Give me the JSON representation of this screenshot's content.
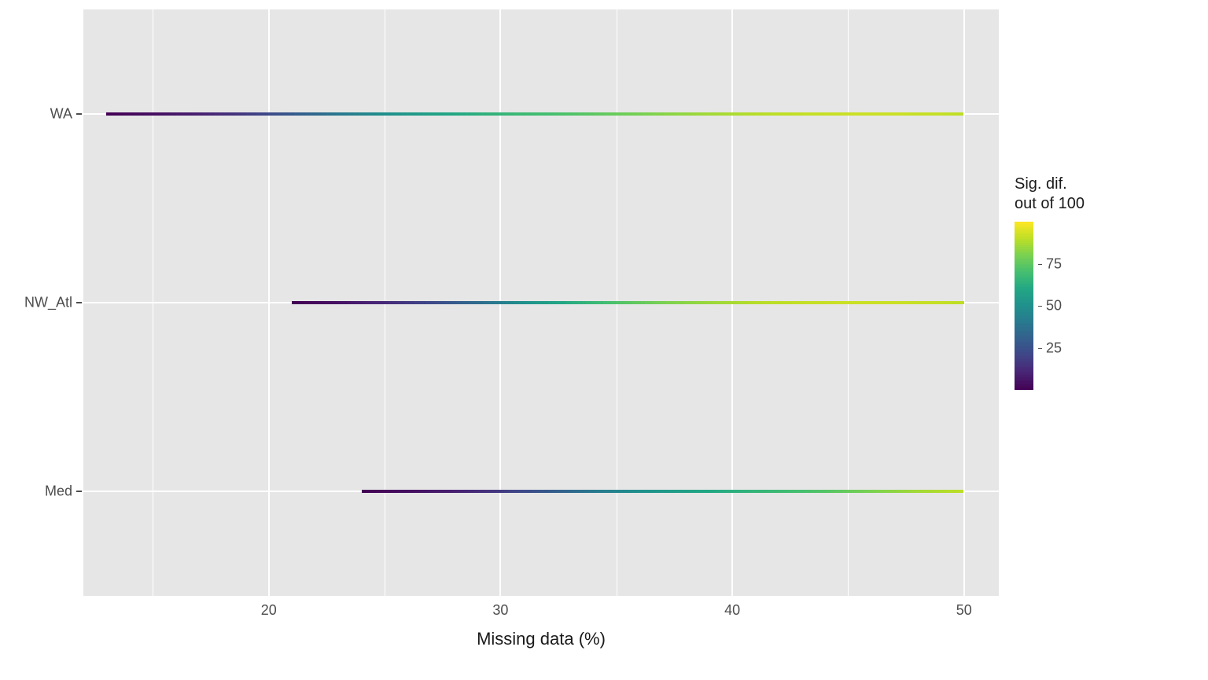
{
  "chart_data": {
    "type": "heatmap",
    "xlabel": "Missing data (%)",
    "ylabel": "",
    "x_range": [
      12,
      51.5
    ],
    "x_ticks": [
      20,
      30,
      40,
      50
    ],
    "x_minor_ticks": [
      15,
      25,
      35,
      45
    ],
    "y_categories": [
      "Med",
      "NW_Atl",
      "WA"
    ],
    "legend_title": "Sig. dif.\nout of 100",
    "color_scale": "viridis",
    "color_domain": [
      0,
      100
    ],
    "legend_ticks": [
      25,
      50,
      75
    ],
    "series": [
      {
        "name": "WA",
        "points": [
          {
            "x": 13,
            "v": 0
          },
          {
            "x": 15,
            "v": 4
          },
          {
            "x": 17,
            "v": 9
          },
          {
            "x": 19,
            "v": 17
          },
          {
            "x": 21,
            "v": 28
          },
          {
            "x": 23,
            "v": 40
          },
          {
            "x": 25,
            "v": 50
          },
          {
            "x": 27,
            "v": 57
          },
          {
            "x": 29,
            "v": 63
          },
          {
            "x": 31,
            "v": 68
          },
          {
            "x": 33,
            "v": 72
          },
          {
            "x": 35,
            "v": 77
          },
          {
            "x": 37,
            "v": 82
          },
          {
            "x": 39,
            "v": 86
          },
          {
            "x": 41,
            "v": 89
          },
          {
            "x": 43,
            "v": 91
          },
          {
            "x": 45,
            "v": 92
          },
          {
            "x": 47,
            "v": 92
          },
          {
            "x": 49,
            "v": 91
          },
          {
            "x": 50,
            "v": 90
          }
        ]
      },
      {
        "name": "NW_Atl",
        "points": [
          {
            "x": 21,
            "v": 0
          },
          {
            "x": 23,
            "v": 5
          },
          {
            "x": 25,
            "v": 12
          },
          {
            "x": 27,
            "v": 22
          },
          {
            "x": 29,
            "v": 35
          },
          {
            "x": 31,
            "v": 50
          },
          {
            "x": 33,
            "v": 62
          },
          {
            "x": 35,
            "v": 72
          },
          {
            "x": 37,
            "v": 80
          },
          {
            "x": 39,
            "v": 85
          },
          {
            "x": 41,
            "v": 89
          },
          {
            "x": 43,
            "v": 91
          },
          {
            "x": 45,
            "v": 92
          },
          {
            "x": 47,
            "v": 92
          },
          {
            "x": 49,
            "v": 91
          },
          {
            "x": 50,
            "v": 90
          }
        ]
      },
      {
        "name": "Med",
        "points": [
          {
            "x": 24,
            "v": 0
          },
          {
            "x": 26,
            "v": 4
          },
          {
            "x": 28,
            "v": 9
          },
          {
            "x": 30,
            "v": 17
          },
          {
            "x": 32,
            "v": 28
          },
          {
            "x": 34,
            "v": 40
          },
          {
            "x": 36,
            "v": 50
          },
          {
            "x": 38,
            "v": 57
          },
          {
            "x": 40,
            "v": 63
          },
          {
            "x": 42,
            "v": 68
          },
          {
            "x": 44,
            "v": 73
          },
          {
            "x": 46,
            "v": 80
          },
          {
            "x": 48,
            "v": 86
          },
          {
            "x": 50,
            "v": 90
          }
        ]
      }
    ]
  }
}
